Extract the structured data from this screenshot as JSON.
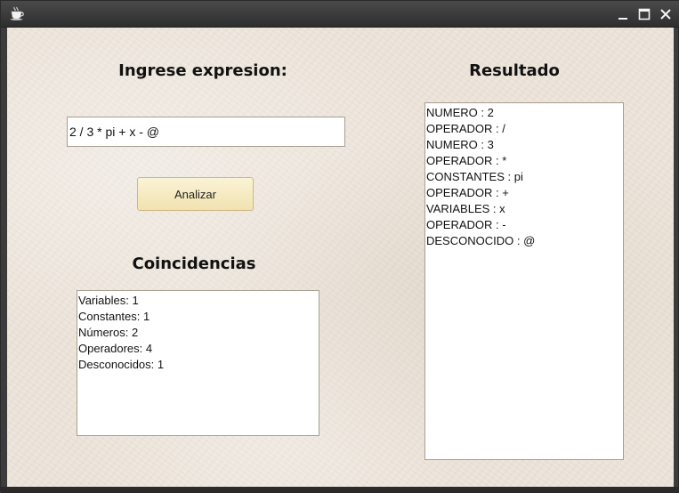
{
  "window": {
    "title": "",
    "app_icon": "coffee-cup-icon",
    "controls": [
      "minimize-icon",
      "maximize-icon",
      "close-icon"
    ]
  },
  "input_section": {
    "heading": "Ingrese expresion:",
    "expression_value": "2 / 3 * pi + x - @",
    "analyze_label": "Analizar"
  },
  "matches_section": {
    "heading": "Coincidencias",
    "lines": [
      "Variables: 1",
      "Constantes: 1",
      "Números: 2",
      "Operadores: 4",
      "Desconocidos: 1"
    ]
  },
  "result_section": {
    "heading": "Resultado",
    "lines": [
      "NUMERO : 2",
      "OPERADOR : /",
      "NUMERO : 3",
      "OPERADOR : *",
      "CONSTANTES : pi",
      "OPERADOR : +",
      "VARIABLES : x",
      "OPERADOR : -",
      "DESCONOCIDO : @"
    ]
  },
  "colors": {
    "background": "#ece4da",
    "button": "#f6ebc4",
    "titlebar": "#3a3a3a"
  }
}
